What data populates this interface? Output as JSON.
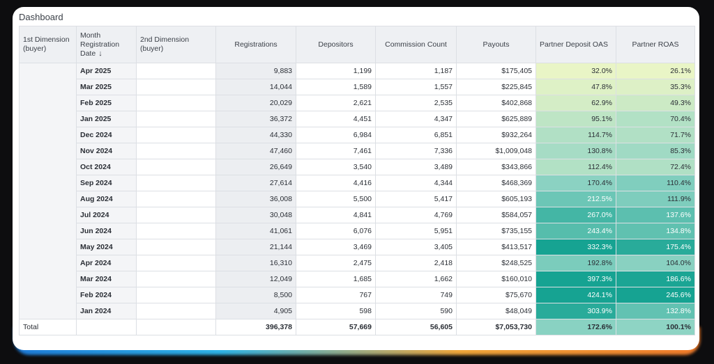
{
  "title": "Dashboard",
  "headers": {
    "dim1": "1st Dimension (buyer)",
    "month": "Month Registration Date",
    "sort_icon": "↓",
    "dim2": "2nd Dimension (buyer)",
    "registrations": "Registrations",
    "depositors": "Depositors",
    "commission": "Commission Count",
    "payouts": "Payouts",
    "pd_oas": "Partner Deposit OAS",
    "roas": "Partner ROAS"
  },
  "rows": [
    {
      "month": "Apr 2025",
      "registrations": "9,883",
      "depositors": "1,199",
      "commission": "1,187",
      "payouts": "$175,405",
      "pd_oas": "32.0%",
      "roas": "26.1%"
    },
    {
      "month": "Mar 2025",
      "registrations": "14,044",
      "depositors": "1,589",
      "commission": "1,557",
      "payouts": "$225,845",
      "pd_oas": "47.8%",
      "roas": "35.3%"
    },
    {
      "month": "Feb 2025",
      "registrations": "20,029",
      "depositors": "2,621",
      "commission": "2,535",
      "payouts": "$402,868",
      "pd_oas": "62.9%",
      "roas": "49.3%"
    },
    {
      "month": "Jan 2025",
      "registrations": "36,372",
      "depositors": "4,451",
      "commission": "4,347",
      "payouts": "$625,889",
      "pd_oas": "95.1%",
      "roas": "70.4%"
    },
    {
      "month": "Dec 2024",
      "registrations": "44,330",
      "depositors": "6,984",
      "commission": "6,851",
      "payouts": "$932,264",
      "pd_oas": "114.7%",
      "roas": "71.7%"
    },
    {
      "month": "Nov 2024",
      "registrations": "47,460",
      "depositors": "7,461",
      "commission": "7,336",
      "payouts": "$1,009,048",
      "pd_oas": "130.8%",
      "roas": "85.3%"
    },
    {
      "month": "Oct 2024",
      "registrations": "26,649",
      "depositors": "3,540",
      "commission": "3,489",
      "payouts": "$343,866",
      "pd_oas": "112.4%",
      "roas": "72.4%"
    },
    {
      "month": "Sep 2024",
      "registrations": "27,614",
      "depositors": "4,416",
      "commission": "4,344",
      "payouts": "$468,369",
      "pd_oas": "170.4%",
      "roas": "110.4%"
    },
    {
      "month": "Aug 2024",
      "registrations": "36,008",
      "depositors": "5,500",
      "commission": "5,417",
      "payouts": "$605,193",
      "pd_oas": "212.5%",
      "roas": "111.9%"
    },
    {
      "month": "Jul 2024",
      "registrations": "30,048",
      "depositors": "4,841",
      "commission": "4,769",
      "payouts": "$584,057",
      "pd_oas": "267.0%",
      "roas": "137.6%"
    },
    {
      "month": "Jun 2024",
      "registrations": "41,061",
      "depositors": "6,076",
      "commission": "5,951",
      "payouts": "$735,155",
      "pd_oas": "243.4%",
      "roas": "134.8%"
    },
    {
      "month": "May 2024",
      "registrations": "21,144",
      "depositors": "3,469",
      "commission": "3,405",
      "payouts": "$413,517",
      "pd_oas": "332.3%",
      "roas": "175.4%"
    },
    {
      "month": "Apr 2024",
      "registrations": "16,310",
      "depositors": "2,475",
      "commission": "2,418",
      "payouts": "$248,525",
      "pd_oas": "192.8%",
      "roas": "104.0%"
    },
    {
      "month": "Mar 2024",
      "registrations": "12,049",
      "depositors": "1,685",
      "commission": "1,662",
      "payouts": "$160,010",
      "pd_oas": "397.3%",
      "roas": "186.6%"
    },
    {
      "month": "Feb 2024",
      "registrations": "8,500",
      "depositors": "767",
      "commission": "749",
      "payouts": "$75,670",
      "pd_oas": "424.1%",
      "roas": "245.6%"
    },
    {
      "month": "Jan 2024",
      "registrations": "4,905",
      "depositors": "598",
      "commission": "590",
      "payouts": "$48,049",
      "pd_oas": "303.9%",
      "roas": "132.8%"
    }
  ],
  "total": {
    "label": "Total",
    "registrations": "396,378",
    "depositors": "57,669",
    "commission": "56,605",
    "payouts": "$7,053,730",
    "pd_oas": "172.6%",
    "roas": "100.1%"
  },
  "colors": {
    "heat_low": "#eaf5c6",
    "heat_mid": "#8fd4c4",
    "heat_high": "#16a392"
  }
}
